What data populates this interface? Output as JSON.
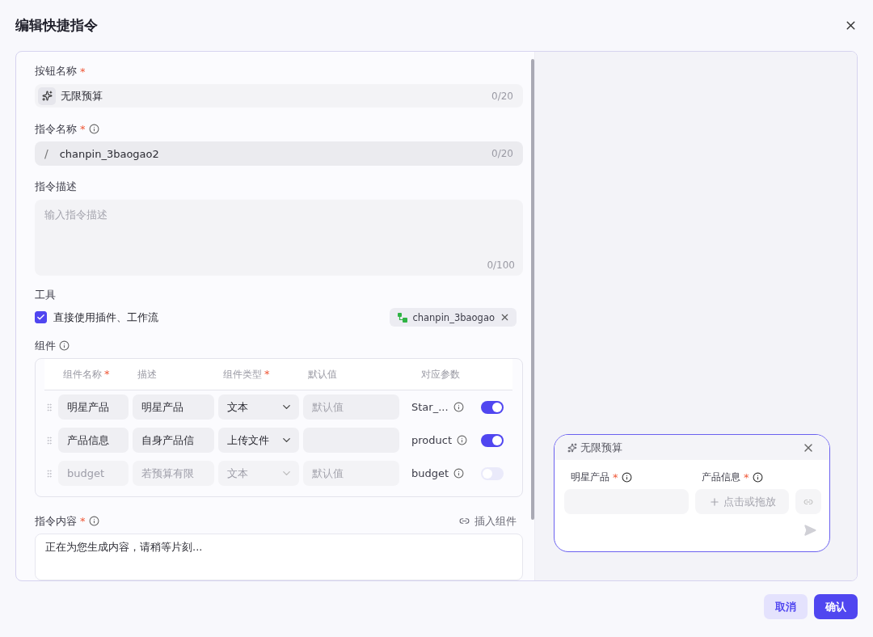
{
  "title": "编辑快捷指令",
  "button_name": {
    "label": "按钮名称",
    "required_mark": "*",
    "value": "无限预算",
    "counter": "0/20"
  },
  "command_name": {
    "label": "指令名称",
    "required_mark": "*",
    "info": true,
    "prefix": "/",
    "value": "chanpin_3baogao2",
    "counter": "0/20"
  },
  "description": {
    "label": "指令描述",
    "placeholder": "输入指令描述",
    "counter": "0/100"
  },
  "tools": {
    "label": "工具",
    "checkbox": {
      "label": "直接使用插件、工作流",
      "checked": true
    },
    "tag": {
      "label": "chanpin_3baogao"
    }
  },
  "components": {
    "label": "组件",
    "info": true,
    "columns": [
      {
        "label": "组件名称",
        "required_mark": "*"
      },
      {
        "label": "描述"
      },
      {
        "label": "组件类型",
        "required_mark": "*"
      },
      {
        "label": "默认值"
      },
      {
        "label": "对应参数"
      }
    ],
    "rows": [
      {
        "name": "明星产品",
        "description": "明星产品",
        "type": "文本",
        "default_placeholder": "默认值",
        "param": "Star_...",
        "enabled": true
      },
      {
        "name": "产品信息",
        "description": "自身产品信",
        "type": "上传文件",
        "param": "product",
        "enabled": true
      },
      {
        "name": "budget",
        "description": "若预算有限",
        "type": "文本",
        "default_placeholder": "默认值",
        "param": "budget",
        "enabled": false
      }
    ]
  },
  "content": {
    "label": "指令内容",
    "required_mark": "*",
    "info": true,
    "insert_label": "插入组件",
    "value": "正在为您生成内容，请稍等片刻..."
  },
  "preview": {
    "title": "无限预算",
    "fields": [
      {
        "kind": "text",
        "label": "明星产品",
        "required_mark": "*",
        "info": true
      },
      {
        "kind": "upload",
        "label": "产品信息",
        "required_mark": "*",
        "info": true,
        "placeholder": "点击或拖放"
      }
    ]
  },
  "buttons": [
    {
      "label": "取消",
      "kind": "secondary"
    },
    {
      "label": "确认",
      "kind": "primary"
    }
  ]
}
